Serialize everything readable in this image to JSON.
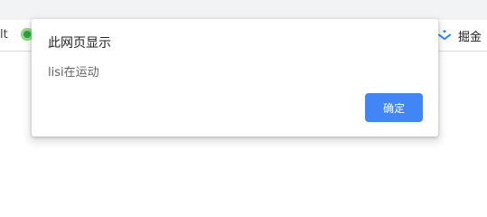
{
  "browser": {
    "bookmark_left_text": "lt",
    "bookmark_right_label": "掘金",
    "bookmark_right_icon": "juejin-icon",
    "bookmark_left_icon": "site-favicon"
  },
  "dialog": {
    "title": "此网页显示",
    "message": "lisi在运动",
    "ok_label": "确定",
    "ok_color": "#4285f4"
  }
}
